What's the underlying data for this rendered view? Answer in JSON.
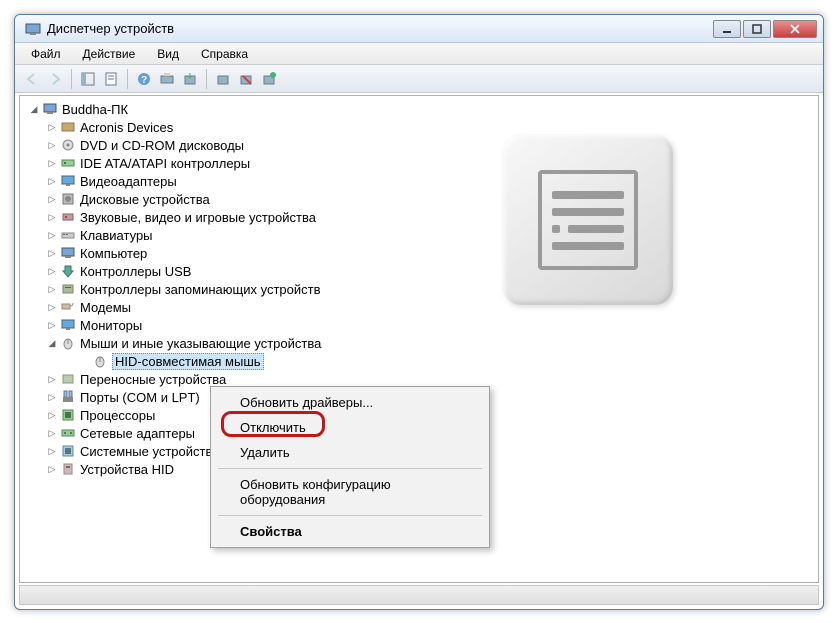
{
  "window": {
    "title": "Диспетчер устройств"
  },
  "menu": {
    "file": "Файл",
    "action": "Действие",
    "view": "Вид",
    "help": "Справка"
  },
  "tree": {
    "root": "Buddha-ПК",
    "items": [
      "Acronis Devices",
      "DVD и CD-ROM дисководы",
      "IDE ATA/ATAPI контроллеры",
      "Видеоадаптеры",
      "Дисковые устройства",
      "Звуковые, видео и игровые устройства",
      "Клавиатуры",
      "Компьютер",
      "Контроллеры USB",
      "Контроллеры запоминающих устройств",
      "Модемы",
      "Мониторы",
      "Мыши и иные указывающие устройства",
      "Переносные устройства",
      "Порты (COM и LPT)",
      "Процессоры",
      "Сетевые адаптеры",
      "Системные устройства",
      "Устройства HID"
    ],
    "selected_child": "HID-совместимая мышь"
  },
  "context_menu": {
    "update_drivers": "Обновить драйверы...",
    "disable": "Отключить",
    "delete": "Удалить",
    "scan": "Обновить конфигурацию оборудования",
    "properties": "Свойства"
  }
}
